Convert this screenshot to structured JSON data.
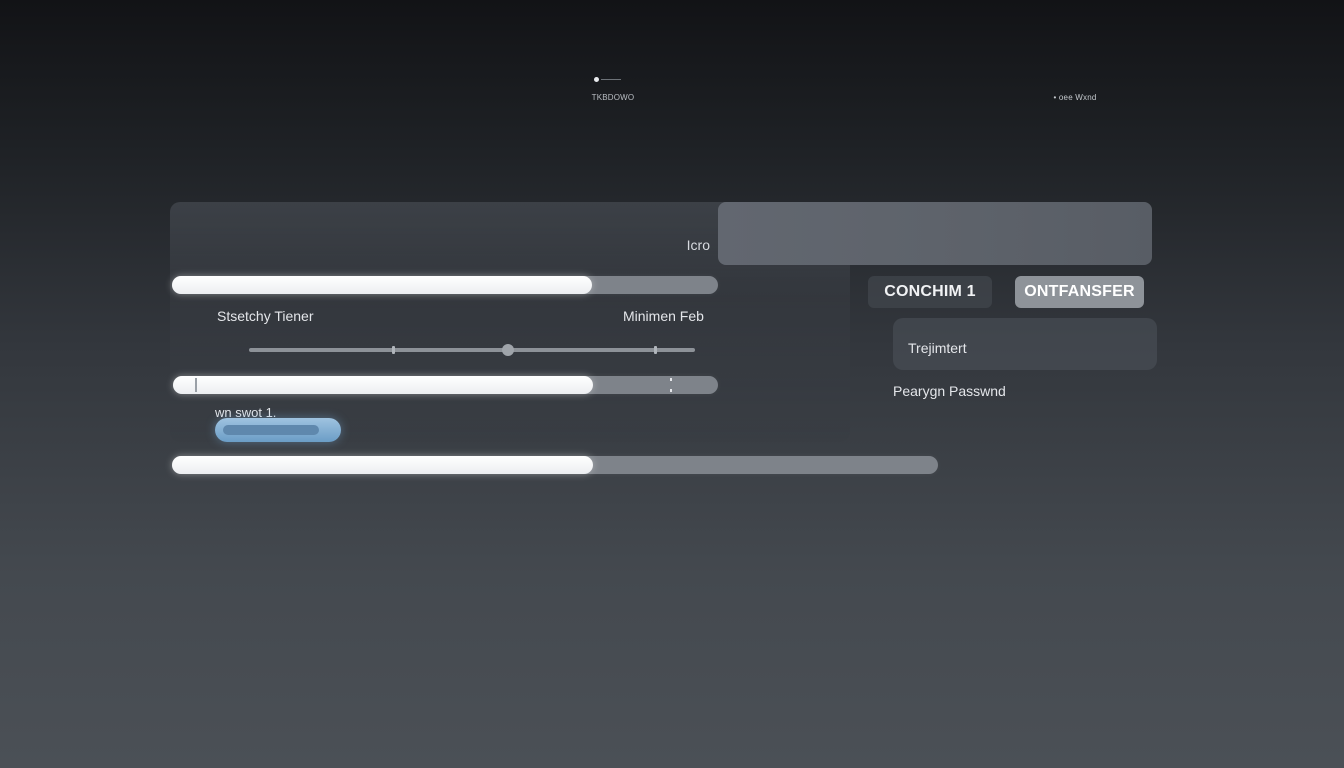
{
  "top": {
    "caption": "TKBDOWO",
    "caption_right": "• oee Wxnd"
  },
  "panel": {
    "header_label": "Icro",
    "left_label": "Stsetchy Tiener",
    "right_label": "Minimen Feb",
    "field_label": "wn swot 1."
  },
  "progress": {
    "bar1_percent": 77,
    "bar2_percent": 77,
    "bar3_percent": 55
  },
  "slider": {
    "value_percent": 58
  },
  "actions": {
    "confirm_label": "CONCHIM 1",
    "transfer_label": "ONTFANSFER"
  },
  "form": {
    "field_label": "Trejimtert",
    "password_label": "Pearygn Passwnd"
  },
  "colors": {
    "accent_blue": "#7aa8cf",
    "bar_fill": "#ffffff",
    "bar_track": "#7e838a"
  }
}
